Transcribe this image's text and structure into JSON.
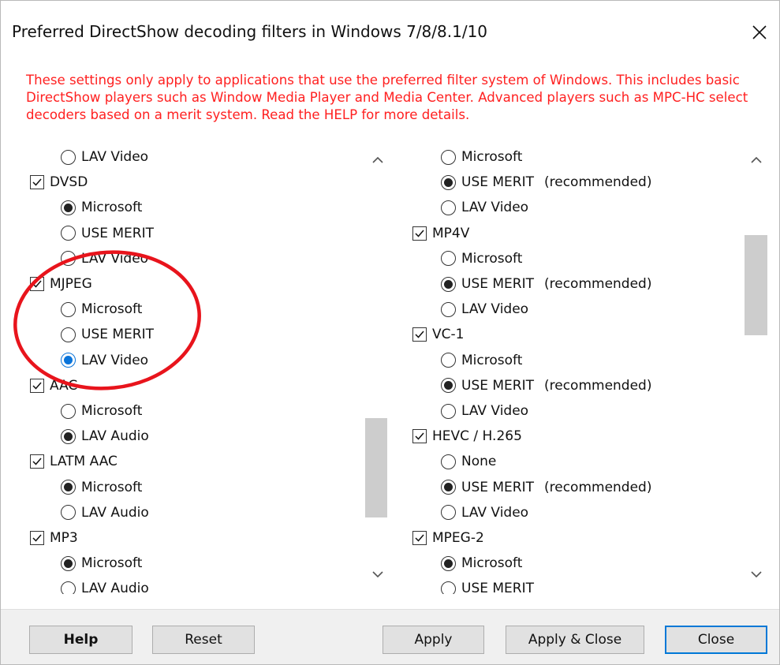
{
  "dialog": {
    "title": "Preferred DirectShow decoding filters in Windows 7/8/8.1/10",
    "close_icon": "close-icon",
    "note": "These settings only apply to applications that use the preferred filter system of Windows. This includes basic DirectShow players such as Window Media Player and Media Center. Advanced players such as MPC-HC select decoders based on a merit system. Read the HELP for more details.",
    "note_color": "#ff2020"
  },
  "left_panel": {
    "items": [
      {
        "kind": "radio",
        "label": "LAV Video",
        "checked": false
      },
      {
        "kind": "checkbox",
        "label": "DVSD",
        "checked": true
      },
      {
        "kind": "radio",
        "label": "Microsoft",
        "checked": true
      },
      {
        "kind": "radio",
        "label": "USE MERIT",
        "checked": false
      },
      {
        "kind": "radio",
        "label": "LAV Video",
        "checked": false
      },
      {
        "kind": "checkbox",
        "label": "MJPEG",
        "checked": true
      },
      {
        "kind": "radio",
        "label": "Microsoft",
        "checked": false
      },
      {
        "kind": "radio",
        "label": "USE MERIT",
        "checked": false
      },
      {
        "kind": "radio",
        "label": "LAV Video",
        "checked": true,
        "focused": true
      },
      {
        "kind": "checkbox",
        "label": "AAC",
        "checked": true
      },
      {
        "kind": "radio",
        "label": "Microsoft",
        "checked": false
      },
      {
        "kind": "radio",
        "label": "LAV Audio",
        "checked": true
      },
      {
        "kind": "checkbox",
        "label": "LATM AAC",
        "checked": true
      },
      {
        "kind": "radio",
        "label": "Microsoft",
        "checked": true
      },
      {
        "kind": "radio",
        "label": "LAV Audio",
        "checked": false
      },
      {
        "kind": "checkbox",
        "label": "MP3",
        "checked": true
      },
      {
        "kind": "radio",
        "label": "Microsoft",
        "checked": true
      },
      {
        "kind": "radio",
        "label": "LAV Audio",
        "checked": false
      }
    ],
    "scroll_position": 0.75
  },
  "right_panel": {
    "items": [
      {
        "kind": "radio",
        "label": "Microsoft",
        "checked": false
      },
      {
        "kind": "radio",
        "label": "USE MERIT",
        "note": "(recommended)",
        "checked": true
      },
      {
        "kind": "radio",
        "label": "LAV Video",
        "checked": false
      },
      {
        "kind": "checkbox",
        "label": "MP4V",
        "checked": true
      },
      {
        "kind": "radio",
        "label": "Microsoft",
        "checked": false
      },
      {
        "kind": "radio",
        "label": "USE MERIT",
        "note": "(recommended)",
        "checked": true
      },
      {
        "kind": "radio",
        "label": "LAV Video",
        "checked": false
      },
      {
        "kind": "checkbox",
        "label": "VC-1",
        "checked": true
      },
      {
        "kind": "radio",
        "label": "Microsoft",
        "checked": false
      },
      {
        "kind": "radio",
        "label": "USE MERIT",
        "note": "(recommended)",
        "checked": true
      },
      {
        "kind": "radio",
        "label": "LAV Video",
        "checked": false
      },
      {
        "kind": "checkbox",
        "label": "HEVC / H.265",
        "checked": true
      },
      {
        "kind": "radio",
        "label": "None",
        "checked": false
      },
      {
        "kind": "radio",
        "label": "USE MERIT",
        "note": "(recommended)",
        "checked": true
      },
      {
        "kind": "radio",
        "label": "LAV Video",
        "checked": false
      },
      {
        "kind": "checkbox",
        "label": "MPEG-2",
        "checked": true
      },
      {
        "kind": "radio",
        "label": "Microsoft",
        "checked": true
      },
      {
        "kind": "radio",
        "label": "USE MERIT",
        "checked": false
      }
    ],
    "scroll_position": 0.3
  },
  "buttons": {
    "help": "Help",
    "reset": "Reset",
    "apply": "Apply",
    "apply_close": "Apply & Close",
    "close": "Close"
  },
  "colors": {
    "annotation_circle": "#e8141c",
    "focus_blue": "#0078d7"
  }
}
